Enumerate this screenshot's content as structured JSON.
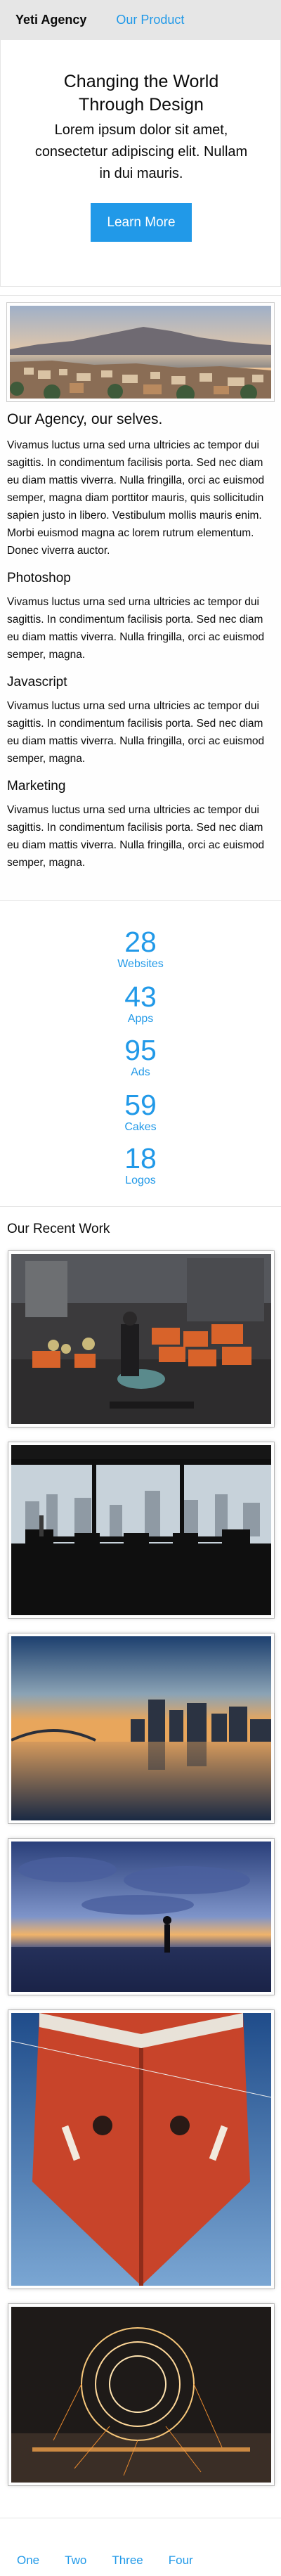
{
  "topbar": {
    "brand": "Yeti Agency",
    "nav_link": "Our Product",
    "background": "#e6e6e6",
    "link_color": "#2199e8"
  },
  "hero": {
    "title": "Changing the World Through Design",
    "lead": "Lorem ipsum dolor sit amet, consectetur adipiscing elit. Nullam in dui mauris.",
    "button_label": "Learn More",
    "button_color": "#2199e8"
  },
  "agency": {
    "heading": "Our Agency, our selves.",
    "intro": "Vivamus luctus urna sed urna ultricies ac tempor dui sagittis. In condimentum facilisis porta. Sed nec diam eu diam mattis viverra. Nulla fringilla, orci ac euismod semper, magna diam porttitor mauris, quis sollicitudin sapien justo in libero. Vestibulum mollis mauris enim. Morbi euismod magna ac lorem rutrum elementum. Donec viverra auctor.",
    "sections": [
      {
        "title": "Photoshop",
        "text": "Vivamus luctus urna sed urna ultricies ac tempor dui sagittis. In condimentum facilisis porta. Sed nec diam eu diam mattis viverra. Nulla fringilla, orci ac euismod semper, magna."
      },
      {
        "title": "Javascript",
        "text": "Vivamus luctus urna sed urna ultricies ac tempor dui sagittis. In condimentum facilisis porta. Sed nec diam eu diam mattis viverra. Nulla fringilla, orci ac euismod semper, magna."
      },
      {
        "title": "Marketing",
        "text": "Vivamus luctus urna sed urna ultricies ac tempor dui sagittis. In condimentum facilisis porta. Sed nec diam eu diam mattis viverra. Nulla fringilla, orci ac euismod semper, magna."
      }
    ]
  },
  "stats": [
    {
      "number": "28",
      "label": "Websites"
    },
    {
      "number": "43",
      "label": "Apps"
    },
    {
      "number": "95",
      "label": "Ads"
    },
    {
      "number": "59",
      "label": "Cakes"
    },
    {
      "number": "18",
      "label": "Logos"
    }
  ],
  "recent_work": {
    "title": "Our Recent Work",
    "images": [
      "market-photo",
      "cafe-window-photo",
      "river-skyline-photo",
      "beach-silhouette-photo",
      "ship-bow-photo",
      "steel-wool-photo"
    ]
  },
  "pager": {
    "links": [
      "One",
      "Two",
      "Three",
      "Four"
    ]
  }
}
